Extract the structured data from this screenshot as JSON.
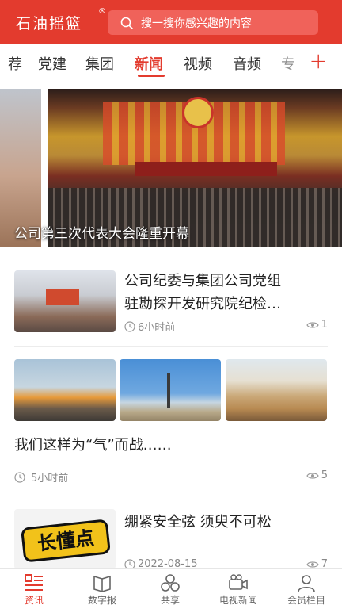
{
  "header": {
    "brand": "石油摇篮",
    "brand_mark": "®",
    "search_placeholder": "搜一搜你感兴趣的内容"
  },
  "tabs": [
    {
      "label": "荐",
      "active": false
    },
    {
      "label": "党建",
      "active": false
    },
    {
      "label": "集团",
      "active": false
    },
    {
      "label": "新闻",
      "active": true
    },
    {
      "label": "视频",
      "active": false
    },
    {
      "label": "音频",
      "active": false
    },
    {
      "label": "专",
      "active": false
    }
  ],
  "tabs_plus_label": "+",
  "banner": {
    "caption": "公司第三次代表大会隆重开幕"
  },
  "news": [
    {
      "title_line1": "公司纪委与集团公司党组",
      "title_line2": "驻勘探开发研究院纪检…",
      "time": "6小时前",
      "views": "1"
    },
    {
      "title": "我们这样为“气”而战……",
      "time": "5小时前",
      "views": "5"
    },
    {
      "title": "绷紧安全弦 须臾不可松",
      "time": "2022-08-15",
      "views": "7",
      "thumb_text": "长懂点"
    }
  ],
  "tabbar": [
    {
      "label": "资讯",
      "icon": "news-grid-icon",
      "active": true
    },
    {
      "label": "数字报",
      "icon": "open-book-icon",
      "active": false
    },
    {
      "label": "共享",
      "icon": "share-circles-icon",
      "active": false
    },
    {
      "label": "电视新闻",
      "icon": "video-camera-icon",
      "active": false
    },
    {
      "label": "会员栏目",
      "icon": "user-icon",
      "active": false
    }
  ],
  "colors": {
    "brand_red": "#e33b2e",
    "text_dark": "#222222",
    "text_gray": "#888888"
  }
}
